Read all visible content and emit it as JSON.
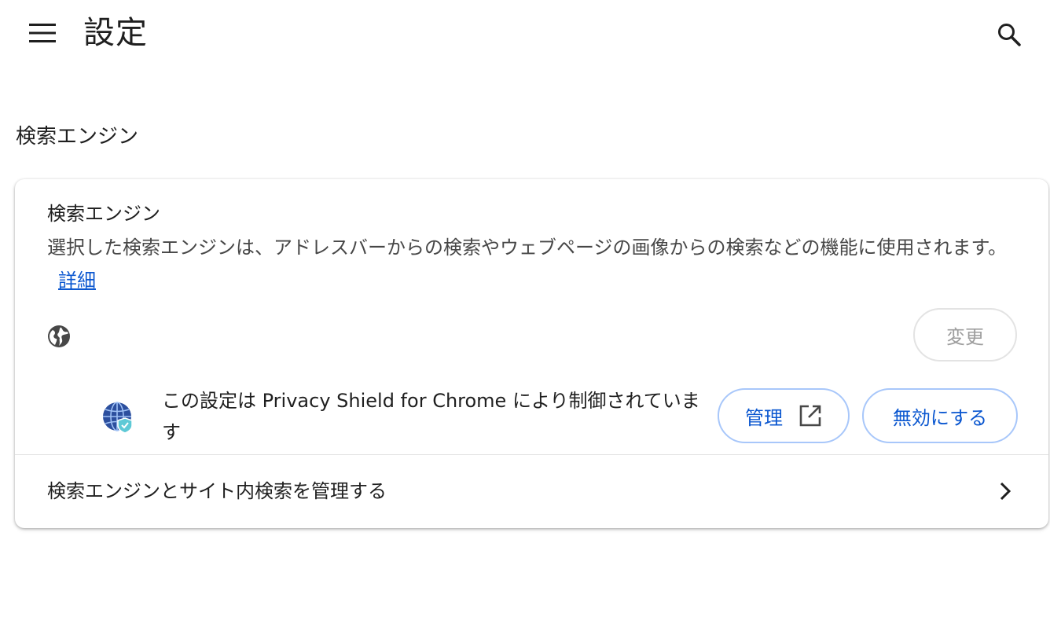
{
  "header": {
    "title": "設定",
    "menu_icon": "hamburger-menu-icon",
    "search_icon": "search-icon"
  },
  "section": {
    "heading": "検索エンジン"
  },
  "card": {
    "title": "検索エンジン",
    "description": "選択した検索エンジンは、アドレスバーからの検索やウェブページの画像からの検索などの機能に使用されます。",
    "learn_more_label": "詳細",
    "change_label": "変更",
    "extension_notice": "この設定は Privacy Shield for Chrome により制御されています",
    "manage_label": "管理",
    "disable_label": "無効にする",
    "manage_row_label": "検索エンジンとサイト内検索を管理する"
  },
  "colors": {
    "accent": "#0b57d0",
    "button_border": "#a8c7fa",
    "disabled_text": "#9e9e9e",
    "text_primary": "#1f1f1f"
  }
}
